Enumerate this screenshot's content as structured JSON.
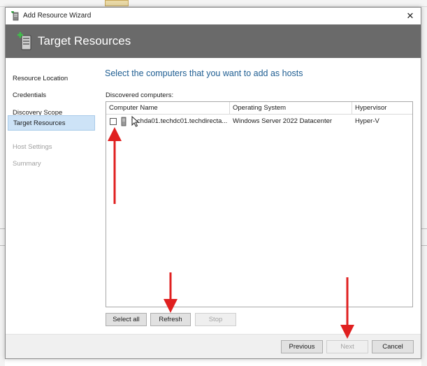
{
  "window": {
    "title": "Add Resource Wizard",
    "close_glyph": "✕",
    "banner_title": "Target Resources"
  },
  "nav": {
    "items": [
      {
        "label": "Resource Location",
        "state": "normal"
      },
      {
        "label": "Credentials",
        "state": "normal"
      },
      {
        "label": "Discovery Scope",
        "state": "normal"
      },
      {
        "label": "Target Resources",
        "state": "active"
      },
      {
        "label": "Host Settings",
        "state": "disabled"
      },
      {
        "label": "Summary",
        "state": "disabled"
      }
    ]
  },
  "content": {
    "heading": "Select the computers that you want to add as hosts",
    "discovered_label": "Discovered computers:",
    "columns": [
      "Computer Name",
      "Operating System",
      "Hypervisor"
    ],
    "rows": [
      {
        "checked": false,
        "computer_name": "techda01.techdc01.techdirecta...",
        "operating_system": "Windows Server 2022 Datacenter",
        "hypervisor": "Hyper-V"
      }
    ]
  },
  "buttons": {
    "select_all": "Select all",
    "refresh": "Refresh",
    "stop": "Stop",
    "previous": "Previous",
    "next": "Next",
    "cancel": "Cancel"
  },
  "colors": {
    "banner": "#6a6a6a",
    "heading": "#1f5e92",
    "nav_active": "#cde3f7",
    "annotation_arrow": "#e02020"
  },
  "icons": {
    "title": "wizard-server-icon",
    "banner": "server-add-icon",
    "row": "server-icon",
    "close": "close-icon"
  }
}
